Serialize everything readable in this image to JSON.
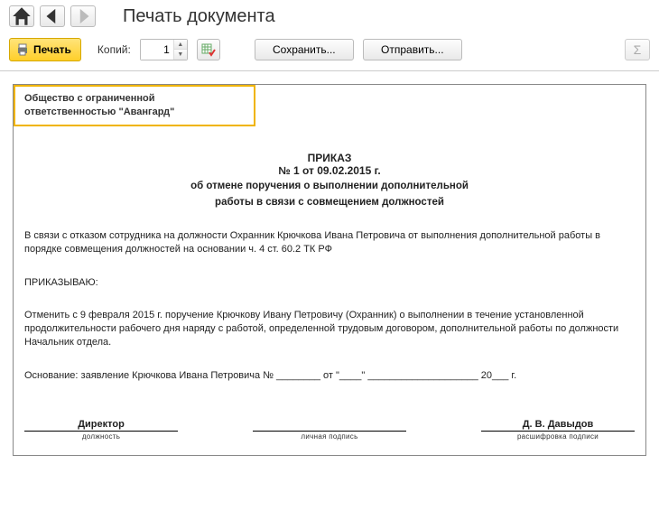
{
  "header": {
    "title": "Печать документа"
  },
  "toolbar": {
    "print_label": "Печать",
    "copies_label": "Копий:",
    "copies_value": "1",
    "save_label": "Сохранить...",
    "send_label": "Отправить...",
    "sigma_label": "Σ"
  },
  "document": {
    "organization": "Общество с ограниченной ответственностью \"Авангард\"",
    "heading": "ПРИКАЗ",
    "number_line": "№ 1 от 09.02.2015 г.",
    "subject_line1": "об отмене поручения о выполнении дополнительной",
    "subject_line2": "работы в связи с совмещением должностей",
    "preamble": "В связи с отказом сотрудника на должности Охранник Крючкова Ивана Петровича от выполнения дополнительной работы в порядке совмещения должностей на основании ч. 4 ст. 60.2 ТК РФ",
    "order_word": "ПРИКАЗЫВАЮ:",
    "order_text": "Отменить с 9 февраля 2015 г. поручение Крючкову Ивану Петровичу (Охранник) о выполнении в течение установленной продолжительности рабочего дня наряду с работой, определенной трудовым договором, дополнительной работы по должности Начальник отдела.",
    "basis": "Основание: заявление Крючкова Ивана Петровича № ________  от \"____\"  ____________________ 20___  г.",
    "signatures": {
      "position_value": "Директор",
      "position_caption": "должность",
      "sign_caption": "личная подпись",
      "name_value": "Д. В. Давыдов",
      "name_caption": "расшифровка подписи"
    }
  }
}
